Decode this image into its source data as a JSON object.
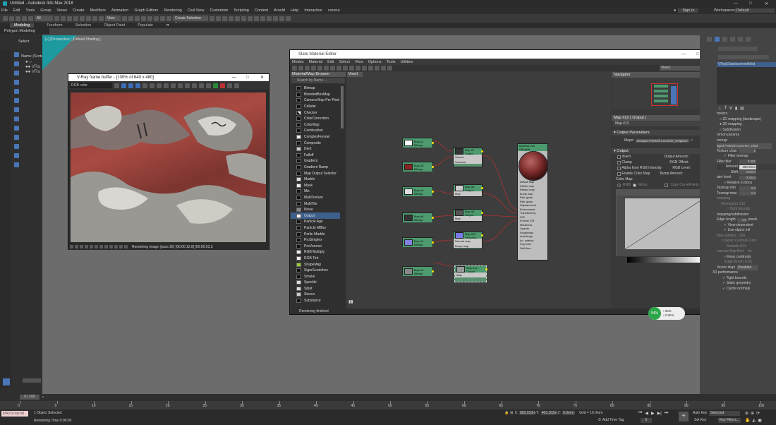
{
  "app": {
    "title": "Untitled - Autodesk 3ds Max 2018",
    "signin": "Sign In",
    "workspaces_label": "Workspaces:",
    "workspaces_value": "Default"
  },
  "menu": [
    "File",
    "Edit",
    "Tools",
    "Group",
    "Views",
    "Create",
    "Modifiers",
    "Animation",
    "Graph Editors",
    "Rendering",
    "Civil View",
    "Customize",
    "Scripting",
    "Content",
    "Arnold",
    "Help",
    "Interactive",
    "corona"
  ],
  "toolbar": {
    "filter": "All",
    "view": "View",
    "selection_set": "Create Selection Set"
  },
  "ribbon": {
    "tabs": [
      "Modeling",
      "Freeform",
      "Selection",
      "Object Paint",
      "Populate"
    ],
    "sub": "Polygon Modeling"
  },
  "left": {
    "select": "Select",
    "name_header": "Name (Sorte"
  },
  "viewport": {
    "label": "[+] [Perspective ] [Default Shading ]"
  },
  "vfb": {
    "title": "V-Ray frame buffer - [100% of 640 x 480]",
    "channel": "RGB color",
    "status": "Rendering image (pass 26) [00:00:12.8] [00:00:53.3"
  },
  "sme": {
    "title": "Slate Material Editor",
    "menu": [
      "Modes",
      "Material",
      "Edit",
      "Select",
      "View",
      "Options",
      "Tools",
      "Utilities"
    ],
    "browser_title": "Material/Map Browser",
    "search": "Search by Name ...",
    "view_tab": "View1",
    "view_dropdown": "View1",
    "navigator": "Navigator",
    "map_panel_title": "Map #12 ( Output )",
    "map_panel_sub": "Map #12",
    "status": "Rendering finished",
    "maps": [
      "Bitmap",
      "BlendedBoxMap",
      "Camera Map Per Pixel",
      "Cellular",
      "Checker",
      "ColorCorrection",
      "ColorMap",
      "Combustion",
      "ComplexFresnel",
      "Composite",
      "Dent",
      "Falloff",
      "Gradient",
      "Gradient Ramp",
      "Map Output Selector",
      "Marble",
      "Mask",
      "Mix",
      "MultiTexture",
      "MultiTile",
      "Noise",
      "Output",
      "Particle Age",
      "Particle MBlur",
      "Perlin Marble",
      "ProSimplex",
      "ProVoronoi",
      "RGB Multiply",
      "RGB Tint",
      "ShapeMap",
      "SigerScratches",
      "Smoke",
      "Speckle",
      "Splat",
      "Stucco",
      "Substance"
    ],
    "selected_map": "Output",
    "nodes": {
      "map1": "Map #1",
      "map1b": "Bitmap",
      "map5": "Map #5",
      "map5b": "Bitmap",
      "map6": "Map #6",
      "map6b": "Bitmap",
      "map4": "Map #4",
      "map4b": "Bitmap",
      "map3": "Map #3",
      "map3b": "Bitmap",
      "map7": "Map #7",
      "map7b": "Shape ...",
      "map7s1": "Source",
      "map7s2": "Sourced",
      "map8": "Map #8",
      "map8b": "Output",
      "map8s": "Map",
      "map9": "Map #9",
      "map9b": "Output",
      "map9s": "Map",
      "map10": "Map #10",
      "map10b": "VRayNor...",
      "map10s1": "Normal map",
      "map10s2": "Bump map",
      "map12": "Map #12",
      "map12b": "Output",
      "map12s": "Map",
      "material": "Material #25",
      "material_type": "VRayMtl",
      "mat_slots": [
        "Diffuse Map",
        "Reflect map",
        "Refract map",
        "Bump map",
        "Refl. gloss.",
        "Refr. gloss.",
        "Displacement",
        "Environment",
        "Translucency",
        "IOR",
        "Fresnel IOR",
        "Metalness",
        "Opacity",
        "Roughness",
        "Anisotropy",
        "An. rotation",
        "Fog color",
        "Self-illum"
      ]
    },
    "output_params": {
      "header": "Output Parameters",
      "maps_label": "Maps:",
      "maps_value": "amaged Painted Concrete_Displace"
    },
    "output": {
      "header": "Output",
      "invert": "Invert",
      "clamp": "Clamp",
      "alpha": "Alpha from RGB Intensity",
      "enable": "Enable Color Map",
      "amount_l": "Output Amount:",
      "amount_v": "1.0",
      "offset_l": "RGB Offset:",
      "offset_v": "0.0",
      "level_l": "RGB Level:",
      "level_v": "1.0",
      "bump_l": "Bump Amount:",
      "bump_v": "1.0",
      "colormap": "Color Map:",
      "rgb": "RGB",
      "mono": "Mono",
      "copy": "Copy CurvePoints"
    }
  },
  "cmd": {
    "modifier": "VRayDisplacementMod",
    "params_title": "meters",
    "type_2d": "2D mapping (landscape)",
    "type_3d": "3D mapping",
    "subdiv": "Subdivision",
    "common": "mmon params",
    "texmap_l": "exmap",
    "texmap_v": "aged Painted Concrete_Displ",
    "tex_chan_l": "Texture chan",
    "tex_chan_v": "1",
    "filter": "Filter texmap",
    "filter_blur_l": "Filter blur",
    "filter_blur_v": "0.001",
    "amount_l": "Amount",
    "amount_v": "100.0mm",
    "shift_l": "Shift",
    "shift_v": "0.0mm",
    "water_l": "ater level",
    "water_v": "0.0mm",
    "relative": "Relative to bbox",
    "texmap_min_l": "Texmap min",
    "texmap_min_v": "0.0",
    "texmap_max_l": "Texmap max",
    "texmap_max_v": "1.0",
    "mapping": "mapping",
    "resolution_l": "Resolution",
    "resolution_v": "512",
    "tight": "Tight bounds",
    "subdiv_head": "mapping/subdivision",
    "edge_l": "Edge length",
    "edge_v": "4.0",
    "pixels": "pixels",
    "view_dep": "View-dependent",
    "object_mtl": "Use object mtl",
    "max_subdivs_l": "Max subdivs",
    "max_subdivs_v": "256",
    "classic": "Classic Catmull-Clark",
    "smooth_uv": "Smooth UVs",
    "preserve_l": "reserve Map Bnd",
    "preserve_v": "Int",
    "keep": "Keep continuity",
    "edge_thresh_l": "Edge thresh",
    "edge_thresh_v": "0.05",
    "vector_l": "Vector displ",
    "vector_v": "Disabled",
    "perf": "3D performance",
    "tight2": "Tight bounds",
    "static": "Static geometry",
    "cache": "Cache normals"
  },
  "timeline": {
    "frame": "0 / 100",
    "ticks": [
      "0",
      "5",
      "10",
      "15",
      "20",
      "25",
      "30",
      "35",
      "40",
      "45",
      "50",
      "55",
      "60",
      "65",
      "70",
      "75",
      "80",
      "85",
      "90",
      "95",
      "100"
    ]
  },
  "status": {
    "maxscript": "MAXScript Mi",
    "selected": "1 Object Selected",
    "render_time": "Rendering Time 0:00:00",
    "x_l": "X:",
    "x_v": "882.033m",
    "y_l": "Y:",
    "y_v": "463.163m",
    "z_l": "Z:",
    "z_v": "0.0mm",
    "grid": "Grid = 10.0mm",
    "addtime": "Add Time Tag",
    "autokey": "Auto Key",
    "setkey": "Set Key",
    "selected_dd": "Selected",
    "keyfilters": "Key Filters...",
    "frame": "0"
  },
  "overlay": {
    "pct": "54%",
    "up": "0K/s",
    "down": "0.3K/s"
  }
}
